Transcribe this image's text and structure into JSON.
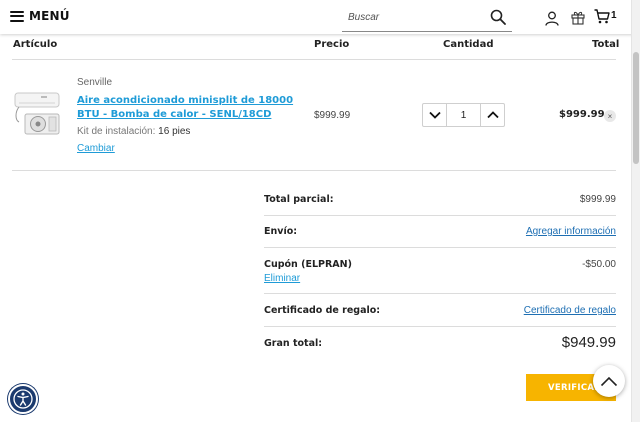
{
  "header": {
    "menu_label": "MENÚ",
    "search_placeholder": "Buscar",
    "cart_count": "1",
    "icons": [
      "hamburger-icon",
      "search-icon",
      "user-icon",
      "gift-icon",
      "cart-icon"
    ]
  },
  "table": {
    "headers": {
      "item": "Artículo",
      "price": "Precio",
      "quantity": "Cantidad",
      "total": "Total"
    }
  },
  "item": {
    "brand": "Senville",
    "name": "Aire acondicionado minisplit de 18000 BTU - Bomba de calor - SENL/18CD",
    "option_label": "Kit de instalación:",
    "option_value": "16 pies",
    "change_label": "Cambiar",
    "price": "$999.99",
    "quantity": "1",
    "total": "$999.99",
    "remove_label": "×"
  },
  "summary": {
    "subtotal_label": "Total parcial:",
    "subtotal_value": "$999.99",
    "shipping_label": "Envío:",
    "shipping_link": "Agregar información",
    "coupon_label": "Cupón (ELPRAN)",
    "coupon_value": "-$50.00",
    "coupon_remove": "Eliminar",
    "gift_label": "Certificado de regalo:",
    "gift_link": "Certificado de regalo",
    "grand_label": "Gran total:",
    "grand_value": "$949.99"
  },
  "checkout_label": "VERIFICAR",
  "colors": {
    "link": "#1e9bd7",
    "checkout": "#f7b400",
    "accessibility": "#1b3a6e"
  }
}
